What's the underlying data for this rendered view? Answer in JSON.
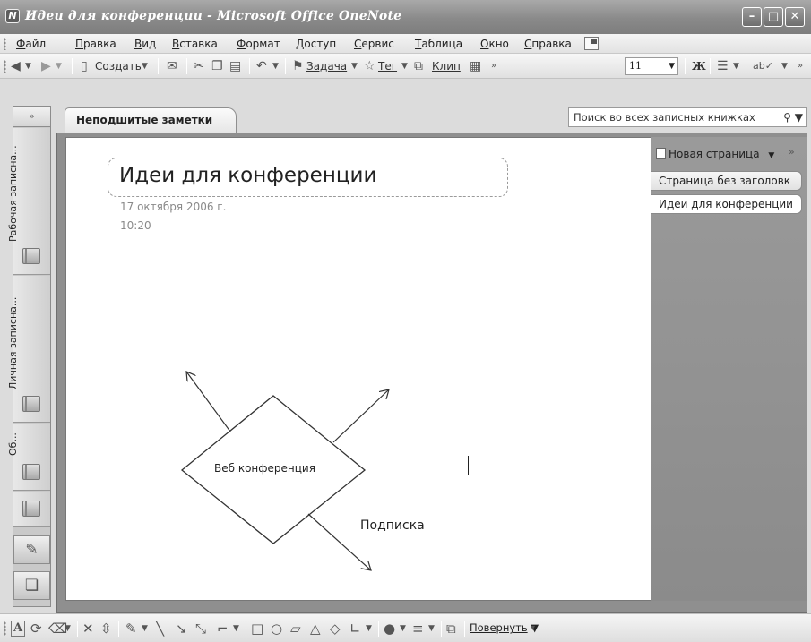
{
  "window": {
    "title": "Идеи для конференции - Microsoft Office OneNote",
    "app_icon": "N",
    "controls": {
      "minimize": "–",
      "maximize": "□",
      "close": "✕"
    }
  },
  "menubar": {
    "items": [
      "Файл",
      "Правка",
      "Вид",
      "Вставка",
      "Формат",
      "Доступ",
      "Сервис",
      "Таблица",
      "Окно",
      "Справка"
    ]
  },
  "toolbar": {
    "back_icon": "◀",
    "forward_icon": "▶",
    "create_label": "Создать",
    "task_label": "Задача",
    "tag_label": "Тег",
    "clip_label": "Клип",
    "font_size": "11",
    "bold_label": "Ж"
  },
  "nav": {
    "collapse": "»",
    "notebooks": [
      {
        "label": "Рабочая записна..."
      },
      {
        "label": "Личная записна..."
      },
      {
        "label": "Об..."
      }
    ]
  },
  "section_tab": {
    "label": "Неподшитые заметки"
  },
  "search": {
    "placeholder": "Поиск во всех записных книжках"
  },
  "page": {
    "title": "Идеи для конференции",
    "date": "17 октября 2006 г.",
    "time": "10:20"
  },
  "diagram": {
    "center_label": "Веб конференция",
    "arrow_label": "Подписка"
  },
  "pages_panel": {
    "new_page_label": "Новая страница",
    "more": "»",
    "pages": [
      "Страница без заголовк",
      "Идеи для конференции"
    ],
    "active_index": 1
  },
  "drawing_toolbar": {
    "rotate_label": "Повернуть"
  }
}
